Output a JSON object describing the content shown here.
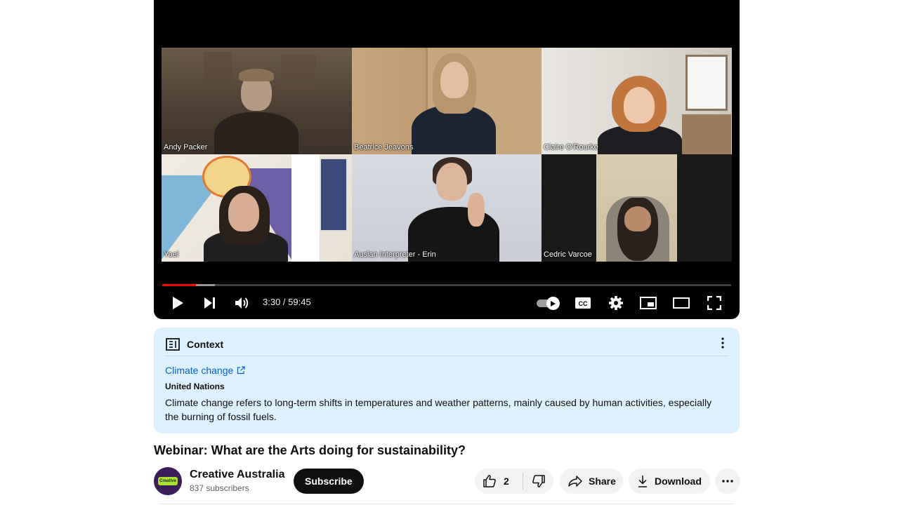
{
  "player": {
    "participants": [
      {
        "name": "Andy Packer"
      },
      {
        "name": "Beatrice Jeavons"
      },
      {
        "name": "Claire O'Rourke"
      },
      {
        "name": "Yael"
      },
      {
        "name": "Auslan Interpreter - Erin"
      },
      {
        "name": "Cedric Varcoe"
      }
    ],
    "time_display": "3:30 / 59:45",
    "progress_played_fraction": 0.059,
    "progress_loaded_fraction": 0.093,
    "accent_color": "#ff0000",
    "controls": {
      "play": "play-icon",
      "next": "next-icon",
      "volume": "volume-icon",
      "autoplay": "autoplay-toggle-icon",
      "captions": "cc-icon",
      "settings": "gear-icon",
      "miniplayer": "miniplayer-icon",
      "theater": "theater-icon",
      "fullscreen": "fullscreen-icon"
    }
  },
  "context": {
    "heading": "Context",
    "link_text": "Climate change",
    "source": "United Nations",
    "description": "Climate change refers to long-term shifts in temperatures and weather patterns, mainly caused by human activities, especially the burning of fossil fuels.",
    "background_color": "#def1ff",
    "link_color": "#065fd4"
  },
  "video": {
    "title": "Webinar: What are the Arts doing for sustainability?"
  },
  "channel": {
    "name": "Creative Australia",
    "subscribers": "837 subscribers",
    "avatar_text": "Creative",
    "subscribe_label": "Subscribe"
  },
  "actions": {
    "like_count": "2",
    "share_label": "Share",
    "download_label": "Download"
  }
}
